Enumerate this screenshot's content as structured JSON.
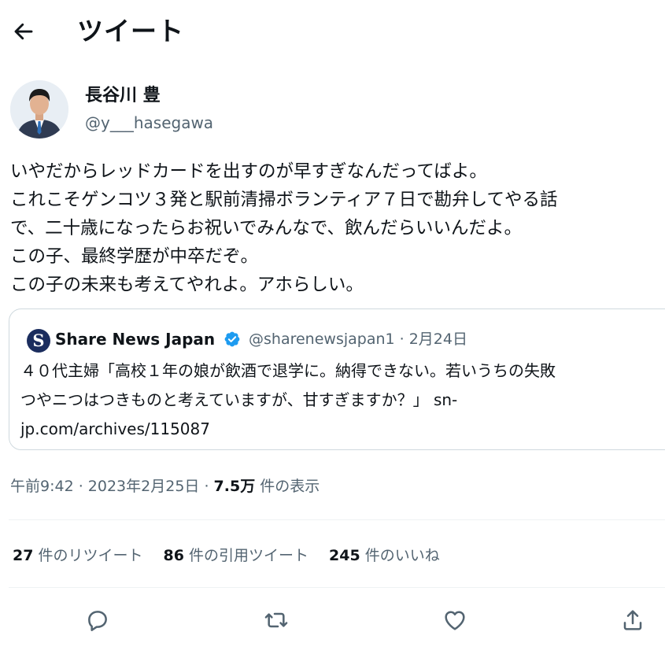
{
  "header": {
    "title": "ツイート",
    "back_icon": "arrow-left-icon"
  },
  "author": {
    "name": "長谷川 豊",
    "handle": "@y___hasegawa"
  },
  "tweet": {
    "lines": [
      "いやだからレッドカードを出すのが早すぎなんだってばよ。",
      "これこそゲンコツ３発と駅前清掃ボランティア７日で勘弁してやる話",
      "で、二十歳になったらお祝いでみんなで、飲んだらいいんだよ。",
      "この子、最終学歴が中卒だぞ。",
      "この子の未来も考えてやれよ。アホらしい。"
    ]
  },
  "quote": {
    "logo_letter": "S",
    "name": "Share News Japan",
    "handle": "@sharenewsjapan1",
    "date": "2月24日",
    "lines": [
      "４０代主婦「高校１年の娘が飲酒で退学に。納得できない。若いうちの失敗",
      "つやニつはつきものと考えていますが、甘すぎますか？」 sn-",
      "jp.com/archives/115087"
    ],
    "verified_color": "#1d9bf0"
  },
  "meta": {
    "time": "午前9:42",
    "date": "2023年2月25日",
    "views": "7.5万",
    "views_label": "件の表示"
  },
  "stats": {
    "retweets": {
      "count": "27",
      "label": "件のリツイート"
    },
    "quotes": {
      "count": "86",
      "label": "件の引用ツイート"
    },
    "likes": {
      "count": "245",
      "label": "件のいいね"
    }
  },
  "actions": [
    "reply-icon",
    "retweet-icon",
    "like-icon",
    "share-icon"
  ]
}
